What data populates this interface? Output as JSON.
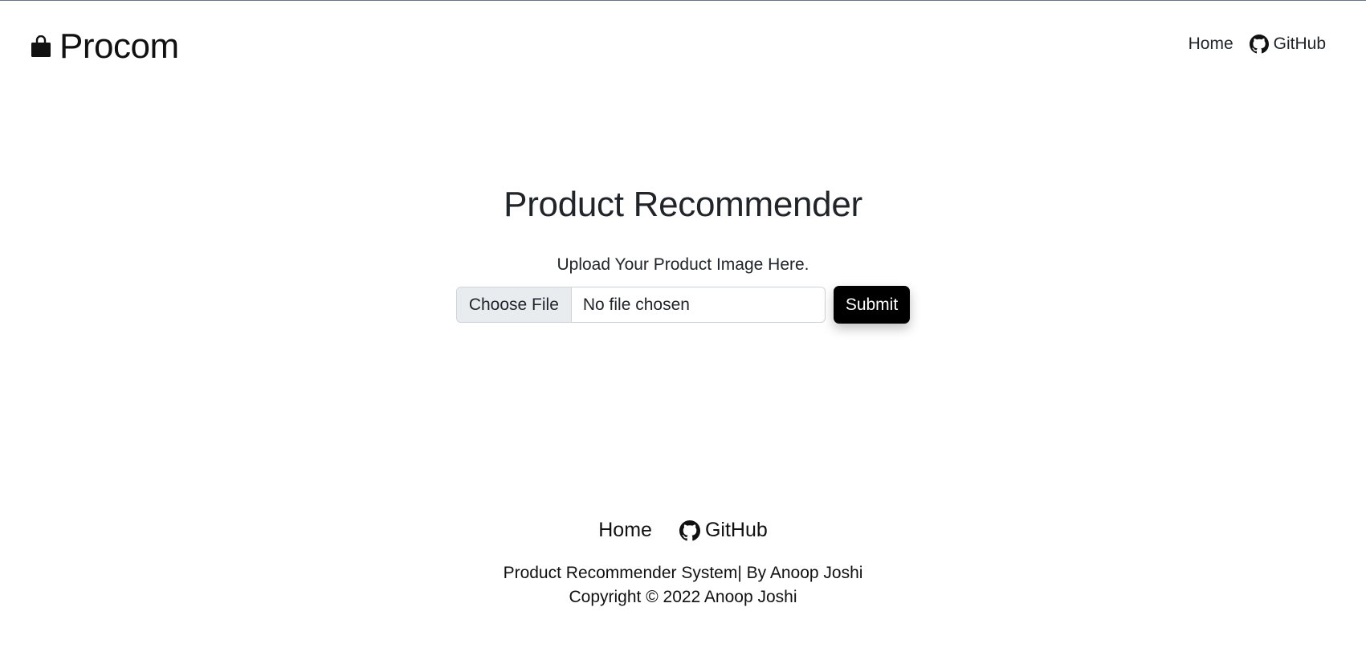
{
  "header": {
    "brand": "Procom",
    "nav": {
      "home": "Home",
      "github": "GitHub"
    }
  },
  "main": {
    "title": "Product Recommender",
    "subtitle": "Upload Your Product Image Here.",
    "file_input": {
      "button_label": "Choose File",
      "status": "No file chosen"
    },
    "submit_label": "Submit"
  },
  "footer": {
    "links": {
      "home": "Home",
      "github": "GitHub"
    },
    "line1": "Product Recommender System| By Anoop Joshi",
    "line2": "Copyright © 2022 Anoop Joshi"
  },
  "icons": {
    "brand": "shopping-bag-icon",
    "github": "github-icon"
  },
  "colors": {
    "submit_bg": "#000000",
    "choose_bg": "#e9ecef"
  }
}
